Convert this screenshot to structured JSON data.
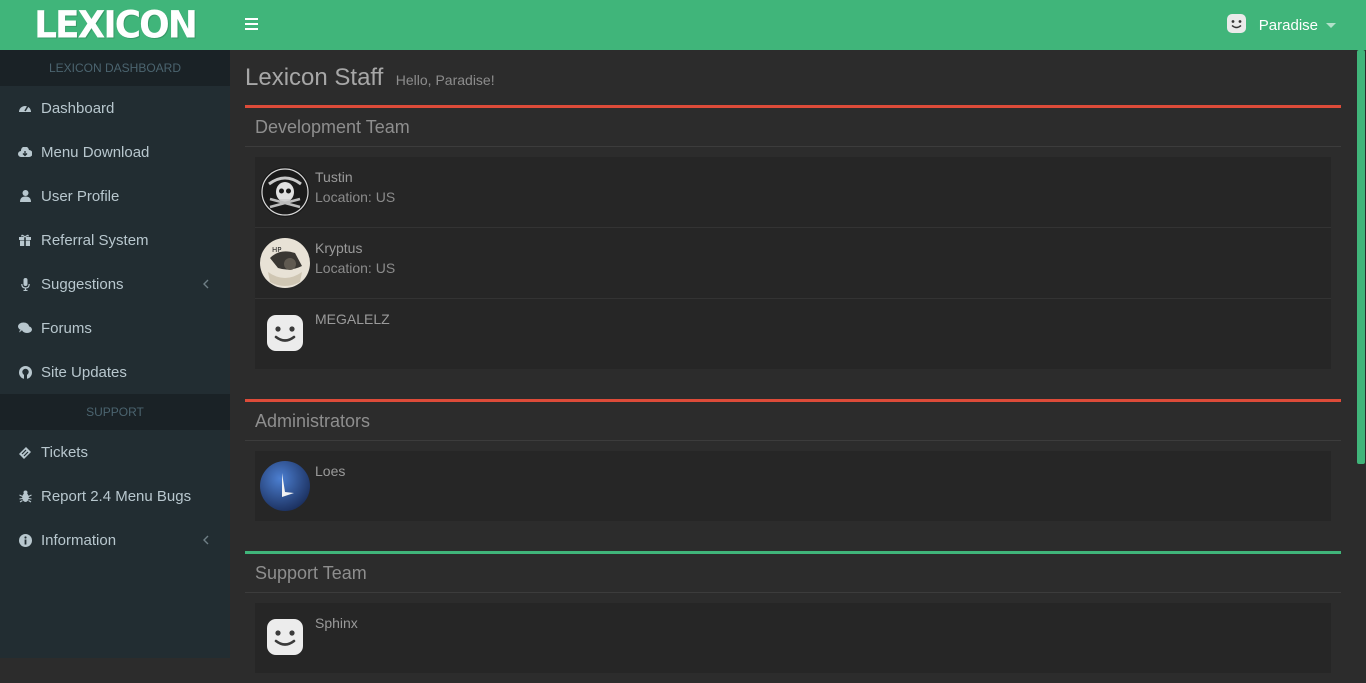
{
  "brand": {
    "logo_text": "LEXICON",
    "accent": "#40b57a"
  },
  "header": {
    "menu_icon": "hamburger-icon",
    "user": {
      "name": "Paradise",
      "avatar_icon": "smiley-face-icon"
    }
  },
  "sidebar": {
    "section_main": "LEXICON DASHBOARD",
    "items": [
      {
        "label": "Dashboard",
        "icon": "dashboard-gauge-icon"
      },
      {
        "label": "Menu Download",
        "icon": "cloud-download-icon"
      },
      {
        "label": "User Profile",
        "icon": "user-icon"
      },
      {
        "label": "Referral System",
        "icon": "gift-icon"
      },
      {
        "label": "Suggestions",
        "icon": "microphone-icon",
        "has_chevron": true
      },
      {
        "label": "Forums",
        "icon": "comments-icon"
      },
      {
        "label": "Site Updates",
        "icon": "github-icon"
      }
    ],
    "section_support": "SUPPORT",
    "support_items": [
      {
        "label": "Tickets",
        "icon": "ticket-icon"
      },
      {
        "label": "Report 2.4 Menu Bugs",
        "icon": "bug-icon"
      },
      {
        "label": "Information",
        "icon": "info-circle-icon",
        "has_chevron": true
      }
    ]
  },
  "page": {
    "title": "Lexicon Staff",
    "subtitle": "Hello, Paradise!"
  },
  "teams": [
    {
      "title": "Development Team",
      "accent": "#dd4b39",
      "members": [
        {
          "name": "Tustin",
          "location": "Location: US",
          "avatar": "skull-avatar"
        },
        {
          "name": "Kryptus",
          "location": "Location: US",
          "avatar": "photo-avatar"
        },
        {
          "name": "MEGALELZ",
          "location": "",
          "avatar": "smiley-face-icon"
        }
      ]
    },
    {
      "title": "Administrators",
      "accent": "#dd4b39",
      "members": [
        {
          "name": "Loes",
          "location": "",
          "avatar": "blue-l-logo-avatar"
        }
      ]
    },
    {
      "title": "Support Team",
      "accent": "#40b57a",
      "members": [
        {
          "name": "Sphinx",
          "location": "",
          "avatar": "smiley-face-icon"
        }
      ]
    }
  ]
}
